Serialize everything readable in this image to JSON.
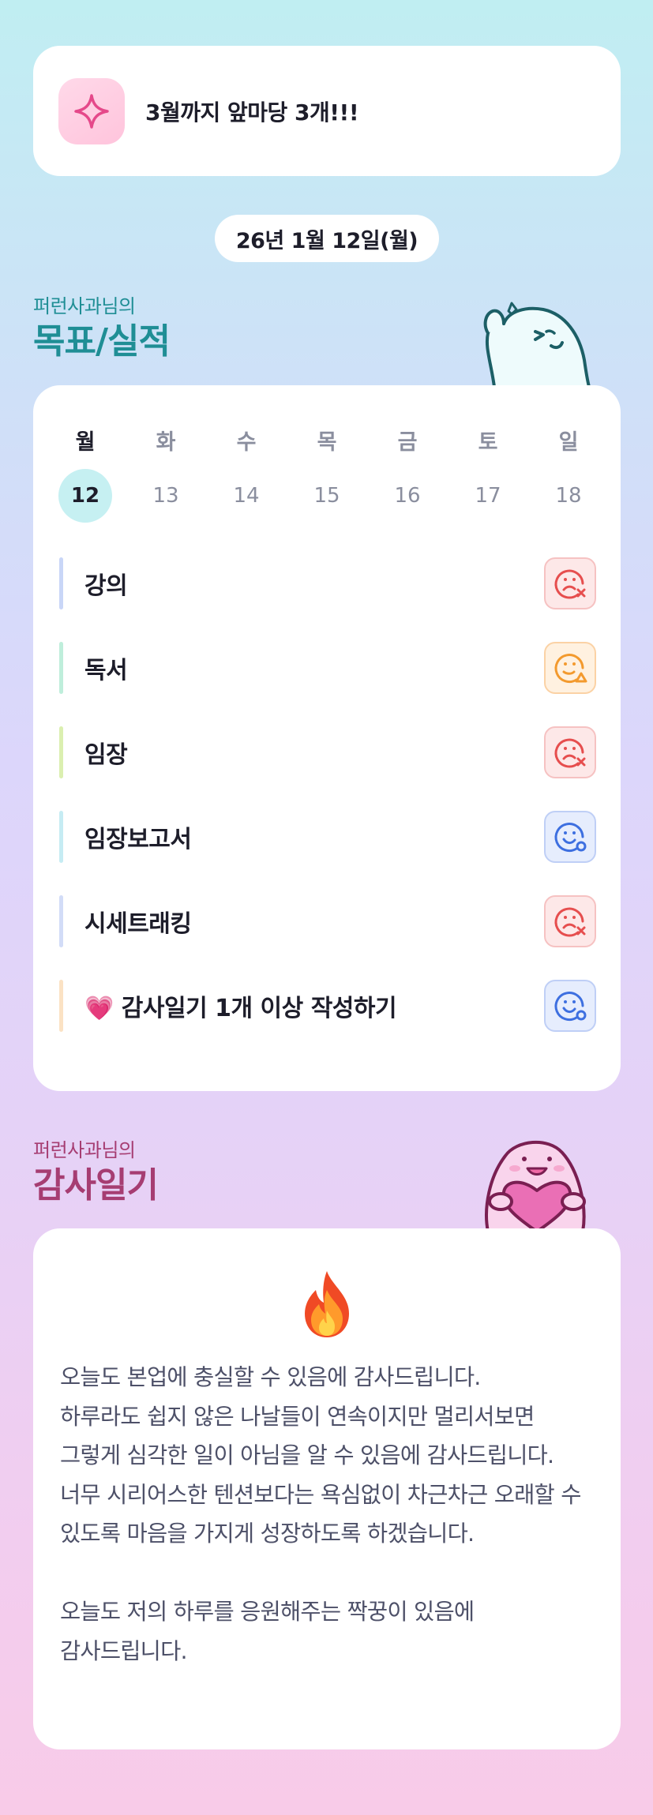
{
  "goal_banner": {
    "icon": "sparkle-icon",
    "text": "3월까지 앞마당 3개!!!"
  },
  "date_label": "26년 1월 12일(월)",
  "goals_section": {
    "subtitle": "퍼런사과님의",
    "title": "목표/실적"
  },
  "week": {
    "days": [
      {
        "weekday": "월",
        "date": "12",
        "active": true
      },
      {
        "weekday": "화",
        "date": "13",
        "active": false
      },
      {
        "weekday": "수",
        "date": "14",
        "active": false
      },
      {
        "weekday": "목",
        "date": "15",
        "active": false
      },
      {
        "weekday": "금",
        "date": "16",
        "active": false
      },
      {
        "weekday": "토",
        "date": "17",
        "active": false
      },
      {
        "weekday": "일",
        "date": "18",
        "active": false
      }
    ]
  },
  "tasks": [
    {
      "label": "강의",
      "bar_color": "#c9d6f7",
      "status": "fail"
    },
    {
      "label": "독서",
      "bar_color": "#bfeedb",
      "status": "warn"
    },
    {
      "label": "임장",
      "bar_color": "#dbefb0",
      "status": "fail"
    },
    {
      "label": "임장보고서",
      "bar_color": "#c6ecf3",
      "status": "ok"
    },
    {
      "label": "시세트래킹",
      "bar_color": "#d2dcf7",
      "status": "fail"
    },
    {
      "label": "💗 감사일기 1개 이상 작성하기",
      "bar_color": "#fbe2c4",
      "status": "ok"
    }
  ],
  "status_colors": {
    "fail": "#e64e4e",
    "warn": "#f39a2e",
    "ok": "#3d6fe0"
  },
  "diary_section": {
    "subtitle": "퍼런사과님의",
    "title": "감사일기"
  },
  "diary": {
    "icon": "fire-icon",
    "text": "오늘도 본업에 충실할 수 있음에 감사드립니다.\n하루라도 쉽지 않은 나날들이 연속이지만 멀리서보면 그렇게 심각한 일이 아님을 알 수 있음에 감사드립니다.\n너무 시리어스한 텐션보다는 욕심없이 차근차근 오래할 수 있도록 마음을 가지게 성장하도록 하겠습니다.\n\n오늘도 저의 하루를 응원해주는 짝꿍이 있음에 감사드립니다."
  },
  "colors": {
    "accent_teal": "#1f8e95",
    "accent_plum": "#a63d72"
  }
}
